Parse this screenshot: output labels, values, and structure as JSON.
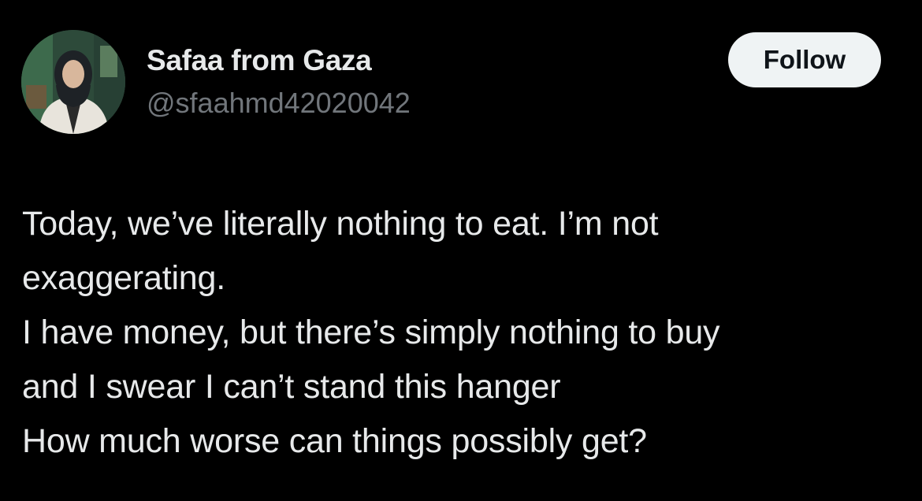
{
  "author": {
    "display_name": "Safaa from Gaza",
    "handle": "@sfaahmd42020042"
  },
  "follow_button": {
    "label": "Follow"
  },
  "tweet": {
    "lines": [
      "Today, we’ve literally nothing to eat. I’m not",
      "exaggerating.",
      "I have money, but there’s simply nothing to buy",
      "and I swear I can’t stand this hanger",
      "How much worse can things possibly get?"
    ]
  },
  "colors": {
    "background": "#000000",
    "primary_text": "#e7e9ea",
    "secondary_text": "#71767b",
    "follow_bg": "#eff3f4",
    "follow_text": "#0f1419"
  }
}
